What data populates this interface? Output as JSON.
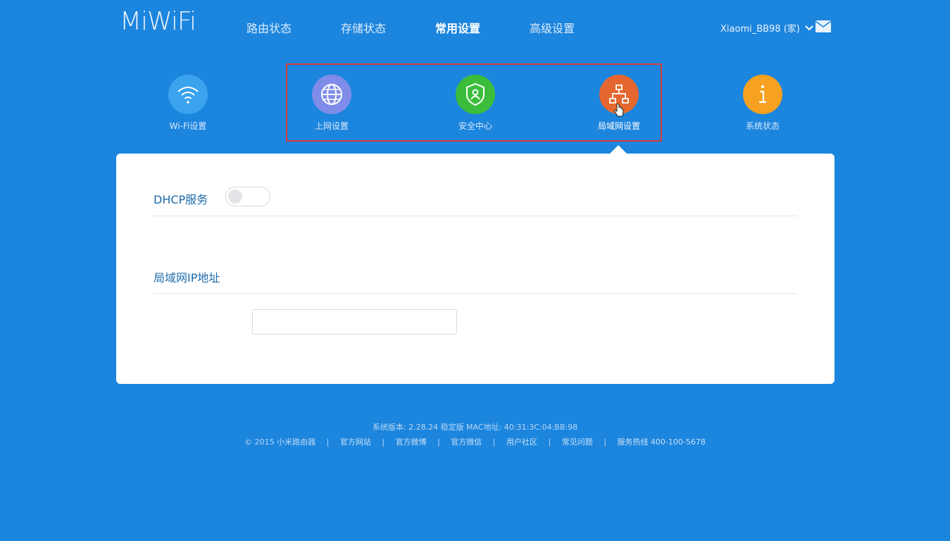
{
  "header": {
    "logo": "MiWiFi",
    "nav": [
      {
        "label": "路由状态",
        "active": false
      },
      {
        "label": "存储状态",
        "active": false
      },
      {
        "label": "常用设置",
        "active": true
      },
      {
        "label": "高级设置",
        "active": false
      }
    ],
    "user_label": "Xiaomi_BB98 (家)",
    "mail_icon": "mail-icon"
  },
  "icons": [
    {
      "label": "Wi-Fi设置",
      "color": "#3aa3ee",
      "icon": "wifi-icon"
    },
    {
      "label": "上网设置",
      "color": "#7f8de8",
      "icon": "globe-icon"
    },
    {
      "label": "安全中心",
      "color": "#3bbd3b",
      "icon": "shield-icon"
    },
    {
      "label": "局域网设置",
      "color": "#e4672f",
      "icon": "network-icon",
      "active": true
    },
    {
      "label": "系统状态",
      "color": "#f6a11f",
      "icon": "info-icon"
    }
  ],
  "panel": {
    "dhcp_label": "DHCP服务",
    "dhcp_enabled": false,
    "lan_ip_label": "局域网IP地址",
    "lan_ip_value": ""
  },
  "footer": {
    "version": "系统版本: 2.28.24 稳定版  MAC地址: 40:31:3C:04:BB:98",
    "copyright": "© 2015 小米路由器",
    "links": [
      "官方网站",
      "官方微博",
      "官方微信",
      "用户社区",
      "常见问题",
      "服务热线 400-100-5678"
    ]
  },
  "colors": {
    "background": "#1c85de",
    "highlight_border": "#d23c3c"
  }
}
